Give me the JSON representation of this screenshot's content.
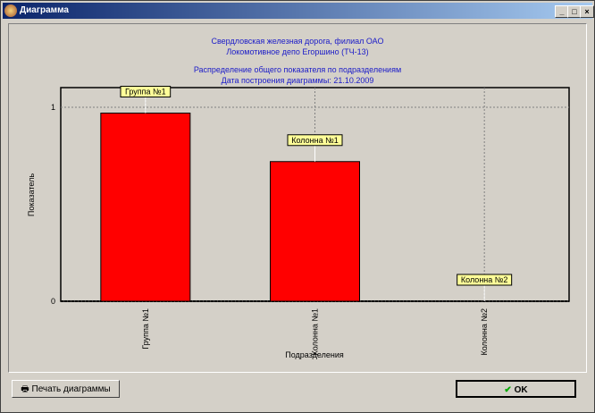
{
  "window": {
    "title": "Диаграмма",
    "minimize": "_",
    "maximize": "□",
    "close": "×"
  },
  "header": {
    "line1": "Свердловская железная дорога, филиал ОАО",
    "line2": "Локомотивное депо Егоршино (ТЧ-13)",
    "line3": "Распределение общего показателя по подразделениям",
    "line4": "Дата построения диаграммы: 21.10.2009"
  },
  "chart_data": {
    "type": "bar",
    "categories": [
      "Группа №1",
      "Колонна №1",
      "Колонна №2"
    ],
    "values": [
      0.97,
      0.72,
      0
    ],
    "xlabel": "Подразделения",
    "ylabel": "Показатель",
    "ylim": [
      0,
      1.1
    ],
    "yticks": [
      "0",
      "1"
    ],
    "bar_color": "#ff0000",
    "grid": true
  },
  "buttons": {
    "print": "Печать диаграммы",
    "ok": "OK"
  }
}
